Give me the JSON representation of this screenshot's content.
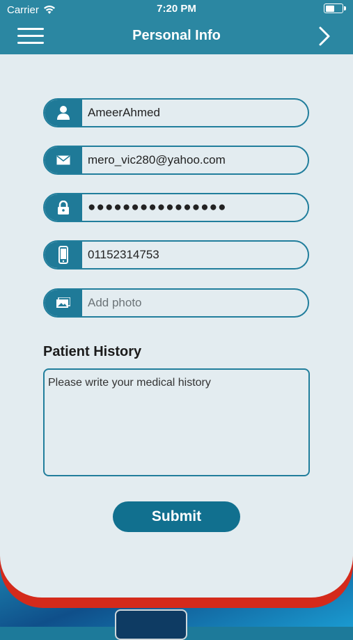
{
  "status_bar": {
    "carrier": "Carrier",
    "time": "7:20 PM"
  },
  "header": {
    "title": "Personal Info",
    "menu_icon": "hamburger-icon",
    "next_icon": "chevron-right-icon"
  },
  "form": {
    "name": {
      "value": "AmeerAhmed",
      "icon": "user-icon"
    },
    "email": {
      "value": "mero_vic280@yahoo.com",
      "icon": "envelope-icon"
    },
    "password": {
      "value": "●●●●●●●●●●●●●●●●",
      "icon": "lock-icon"
    },
    "phone": {
      "value": "01152314753",
      "icon": "phone-icon"
    },
    "photo": {
      "placeholder": "Add photo",
      "icon": "image-icon"
    }
  },
  "history": {
    "title": "Patient History",
    "placeholder": "Please write your medical history"
  },
  "submit_label": "Submit",
  "colors": {
    "primary": "#2b87a2",
    "field_border": "#217e9c",
    "accent_red": "#d42a1b",
    "background": "#e3ecf0"
  }
}
